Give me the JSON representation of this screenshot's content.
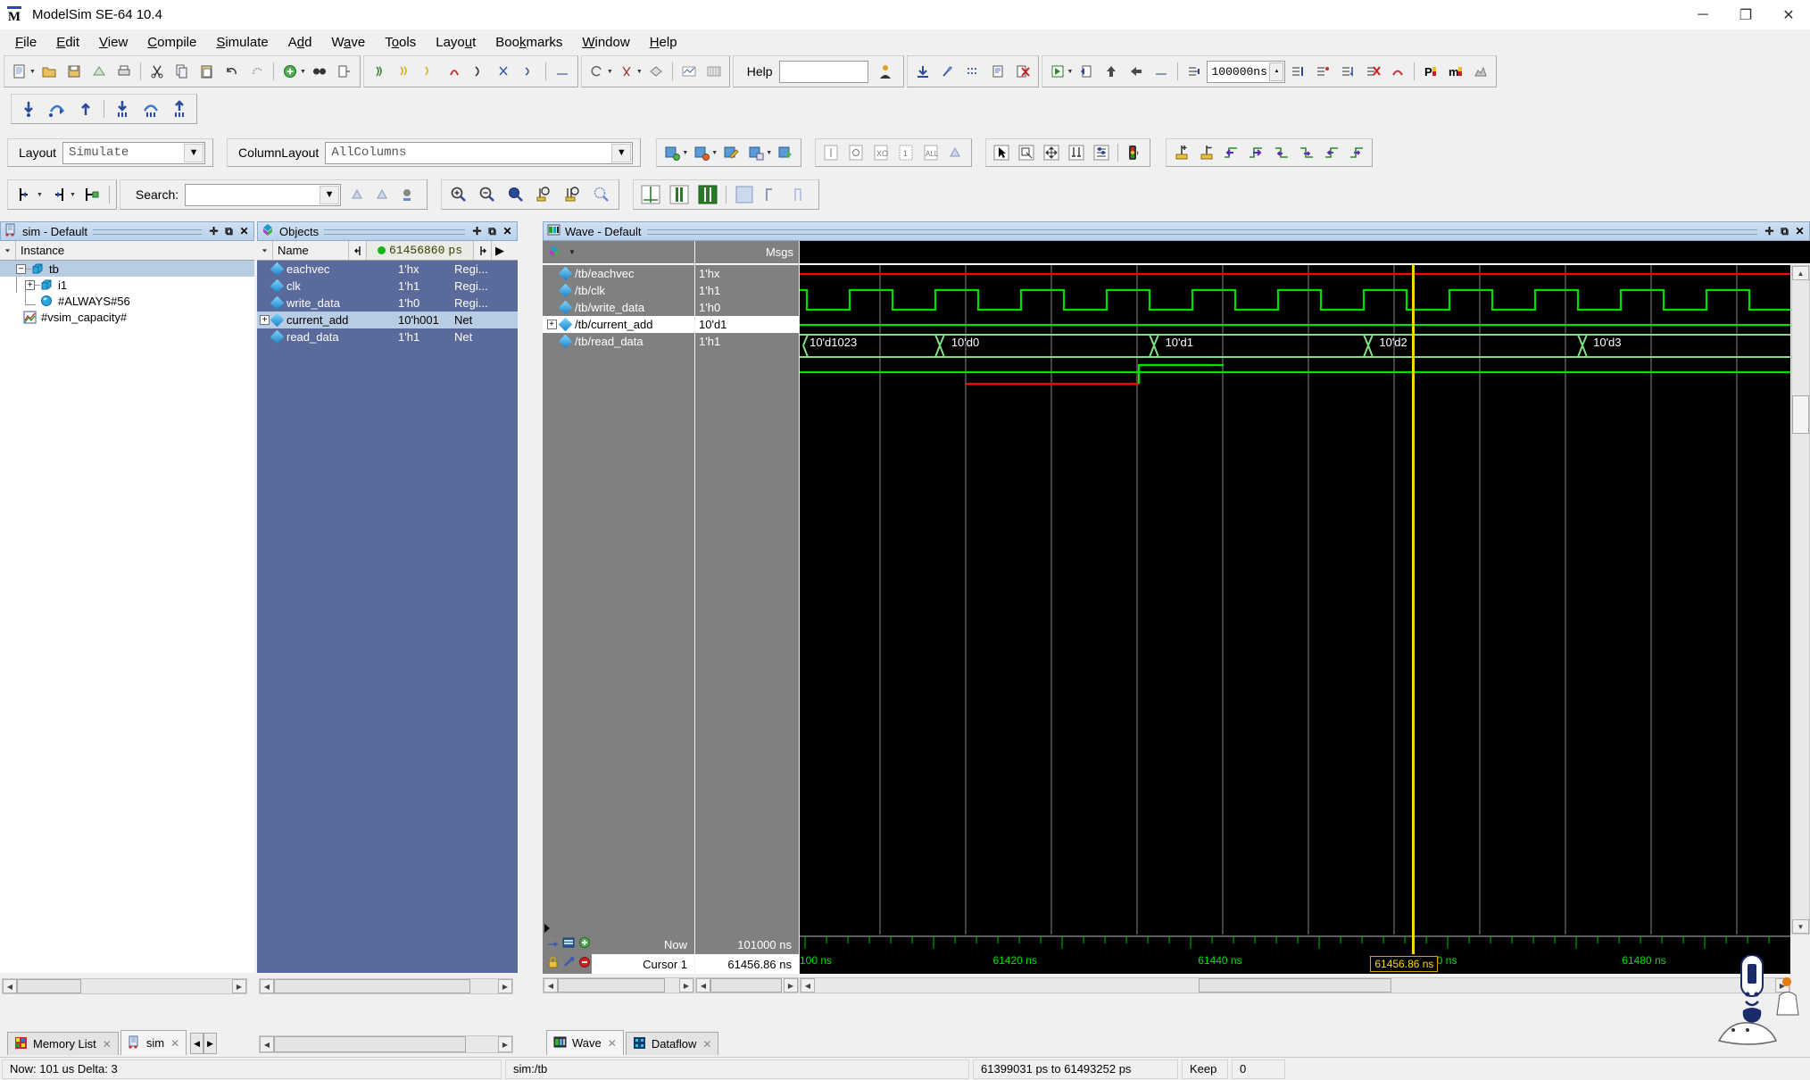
{
  "window": {
    "title": "ModelSim SE-64 10.4",
    "app_icon": "modelsim-icon",
    "minimize": "─",
    "maximize": "❐",
    "close": "✕"
  },
  "menubar": {
    "items": [
      {
        "label": "File"
      },
      {
        "label": "Edit"
      },
      {
        "label": "View"
      },
      {
        "label": "Compile"
      },
      {
        "label": "Simulate"
      },
      {
        "label": "Add"
      },
      {
        "label": "Wave"
      },
      {
        "label": "Tools"
      },
      {
        "label": "Layout"
      },
      {
        "label": "Bookmarks"
      },
      {
        "label": "Window"
      },
      {
        "label": "Help"
      }
    ]
  },
  "toolbar": {
    "help_label": "Help",
    "help_value": "",
    "run_length": "100000ns"
  },
  "layoutbar": {
    "layout_label": "Layout",
    "layout_value": "Simulate",
    "columnlayout_label": "ColumnLayout",
    "columnlayout_value": "AllColumns"
  },
  "searchbar": {
    "search_label": "Search:",
    "search_value": ""
  },
  "sim_panel": {
    "title": "sim - Default",
    "column_header": "Instance",
    "rows": [
      {
        "label": "tb",
        "indent": 0,
        "expander": "-",
        "icon": "module-icon",
        "selected": true
      },
      {
        "label": "i1",
        "indent": 1,
        "expander": "+",
        "icon": "module-icon",
        "selected": false
      },
      {
        "label": "#ALWAYS#56",
        "indent": 2,
        "expander": "",
        "icon": "process-icon",
        "selected": false
      },
      {
        "label": "#vsim_capacity#",
        "indent": 0,
        "expander": "",
        "icon": "capacity-icon",
        "selected": false
      }
    ]
  },
  "objects_panel": {
    "title": "Objects",
    "column_header_name": "Name",
    "time_value": "61456860",
    "time_unit": "ps",
    "rows": [
      {
        "name": "eachvec",
        "value": "1'hx",
        "kind": "Regi...",
        "expander": false,
        "selected": false
      },
      {
        "name": "clk",
        "value": "1'h1",
        "kind": "Regi...",
        "expander": false,
        "selected": false
      },
      {
        "name": "write_data",
        "value": "1'h0",
        "kind": "Regi...",
        "expander": false,
        "selected": false
      },
      {
        "name": "current_add",
        "value": "10'h001",
        "kind": "Net",
        "expander": true,
        "selected": true
      },
      {
        "name": "read_data",
        "value": "1'h1",
        "kind": "Net",
        "expander": false,
        "selected": false
      }
    ]
  },
  "wave_panel": {
    "title": "Wave - Default",
    "msgs_header": "Msgs",
    "signals": [
      {
        "name": "/tb/eachvec",
        "value": "1'hx",
        "expander": false,
        "selected": false,
        "color": "#ff0000",
        "type": "flat-x"
      },
      {
        "name": "/tb/clk",
        "value": "1'h1",
        "expander": false,
        "selected": false,
        "color": "#00e000",
        "type": "clock"
      },
      {
        "name": "/tb/write_data",
        "value": "1'h0",
        "expander": false,
        "selected": false,
        "color": "#00e000",
        "type": "low"
      },
      {
        "name": "/tb/current_add",
        "value": "10'd1",
        "expander": true,
        "selected": true,
        "color": "#00e000",
        "type": "bus"
      },
      {
        "name": "/tb/read_data",
        "value": "1'h1",
        "expander": false,
        "selected": false,
        "color": "#00e000",
        "type": "data"
      }
    ],
    "bus_values": [
      "10'd1023",
      "10'd0",
      "10'd1",
      "10'd2",
      "10'd3"
    ],
    "time_axis_labels": [
      "100 ns",
      "61420 ns",
      "61440 ns",
      "61460 ns",
      "61480 ns"
    ],
    "cursor_label": "61456.86 ns",
    "now_label": "Now",
    "now_value": "101000 ns",
    "cursor_name": "Cursor 1",
    "cursor_value": "61456.86 ns"
  },
  "bottom_tabs_left": [
    {
      "label": "Memory List",
      "icon": "memory-icon",
      "active": false
    },
    {
      "label": "sim",
      "icon": "sim-icon",
      "active": true
    }
  ],
  "bottom_tabs_right": [
    {
      "label": "Wave",
      "icon": "wave-icon",
      "active": true
    },
    {
      "label": "Dataflow",
      "icon": "dataflow-icon",
      "active": false
    }
  ],
  "statusbar": {
    "now": "Now: 101 us  Delta: 3",
    "context": "sim:/tb",
    "range": "61399031 ps to 61493252 ps",
    "keep_label": "Keep",
    "keep_value": "0"
  },
  "colors": {
    "title_panel": "#b9d2ec",
    "objects_bg": "#5a6a9a",
    "wave_bg": "#000000",
    "signal_green": "#00e000",
    "signal_red": "#ff0000",
    "cursor_yellow": "#ffd700",
    "selection_blue": "#b8cce4"
  }
}
